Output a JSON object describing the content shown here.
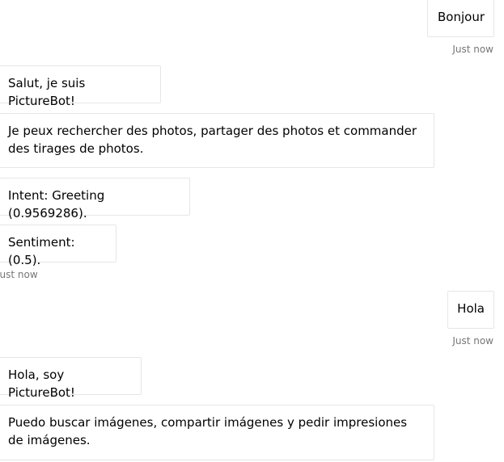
{
  "conversation": {
    "user_1": {
      "text": "Bonjour",
      "timestamp": "Just now"
    },
    "bot_group_1": {
      "messages": [
        "Salut, je suis PictureBot!",
        "Je peux rechercher des photos, partager des photos et commander des tirages de photos.",
        "Intent: Greeting (0.9569286).",
        "Sentiment: (0.5)."
      ],
      "timestamp": "Just now"
    },
    "user_2": {
      "text": "Hola",
      "timestamp": "Just now"
    },
    "bot_group_2": {
      "messages": [
        "Hola, soy PictureBot!",
        "Puedo buscar imágenes, compartir imágenes y pedir impresiones de imágenes."
      ]
    }
  },
  "colors": {
    "bubble_border": "#e6e6e6",
    "timestamp_text": "#767676",
    "background": "#ffffff"
  }
}
